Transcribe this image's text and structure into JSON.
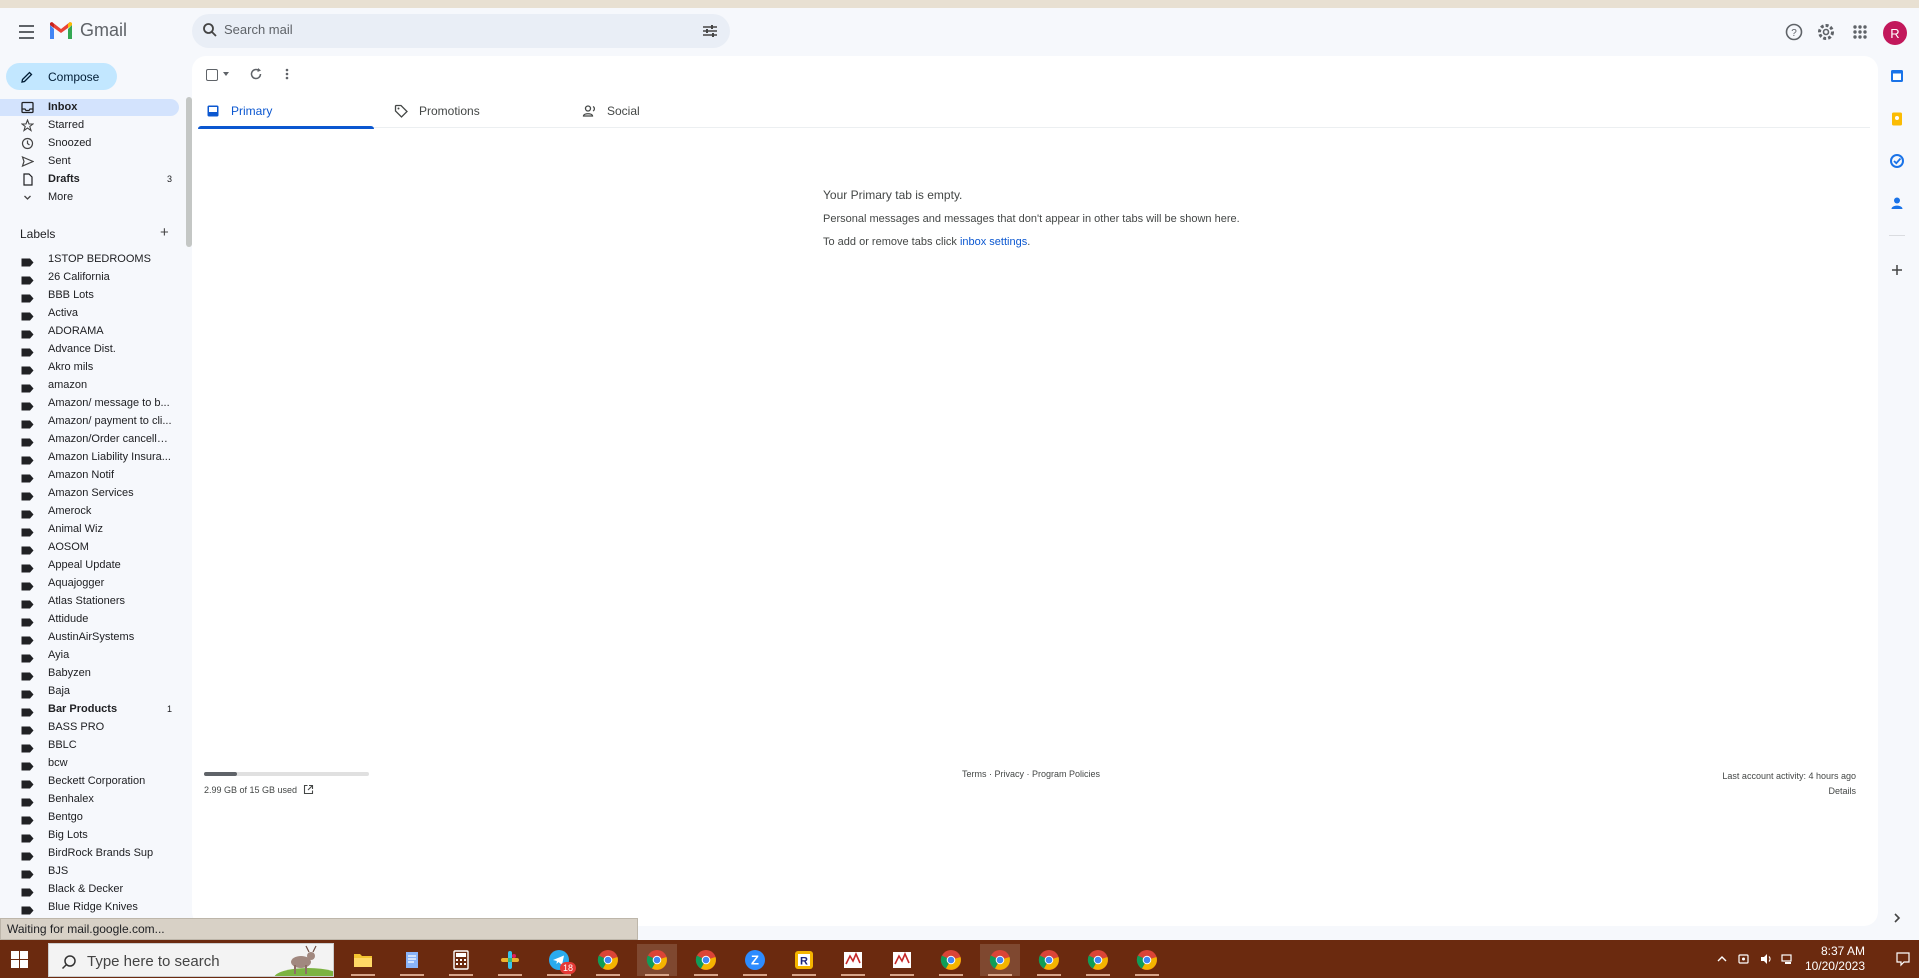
{
  "app": {
    "name": "Gmail"
  },
  "search": {
    "placeholder": "Search mail"
  },
  "avatar": {
    "letter": "R",
    "color": "#c2185b"
  },
  "compose": {
    "label": "Compose"
  },
  "nav": [
    {
      "label": "Inbox",
      "icon": "inbox-icon",
      "active": true,
      "bold": true,
      "count": ""
    },
    {
      "label": "Starred",
      "icon": "star-icon",
      "active": false,
      "bold": false,
      "count": ""
    },
    {
      "label": "Snoozed",
      "icon": "clock-icon",
      "active": false,
      "bold": false,
      "count": ""
    },
    {
      "label": "Sent",
      "icon": "send-icon",
      "active": false,
      "bold": false,
      "count": ""
    },
    {
      "label": "Drafts",
      "icon": "draft-icon",
      "active": false,
      "bold": true,
      "count": "3"
    },
    {
      "label": "More",
      "icon": "chevron-down-icon",
      "active": false,
      "bold": false,
      "count": ""
    }
  ],
  "labels": {
    "header": "Labels",
    "items": [
      {
        "label": "1STOP BEDROOMS",
        "bold": false,
        "count": ""
      },
      {
        "label": "26 California",
        "bold": false,
        "count": ""
      },
      {
        "label": "BBB Lots",
        "bold": false,
        "count": ""
      },
      {
        "label": "Activa",
        "bold": false,
        "count": ""
      },
      {
        "label": "ADORAMA",
        "bold": false,
        "count": ""
      },
      {
        "label": "Advance Dist.",
        "bold": false,
        "count": ""
      },
      {
        "label": "Akro mils",
        "bold": false,
        "count": ""
      },
      {
        "label": "amazon",
        "bold": false,
        "count": ""
      },
      {
        "label": "Amazon/ message to b...",
        "bold": false,
        "count": ""
      },
      {
        "label": "Amazon/ payment to cli...",
        "bold": false,
        "count": ""
      },
      {
        "label": "Amazon/Order cancella...",
        "bold": false,
        "count": ""
      },
      {
        "label": "Amazon Liability Insura...",
        "bold": false,
        "count": ""
      },
      {
        "label": "Amazon Notif",
        "bold": false,
        "count": ""
      },
      {
        "label": "Amazon Services",
        "bold": false,
        "count": ""
      },
      {
        "label": "Amerock",
        "bold": false,
        "count": ""
      },
      {
        "label": "Animal Wiz",
        "bold": false,
        "count": ""
      },
      {
        "label": "AOSOM",
        "bold": false,
        "count": ""
      },
      {
        "label": "Appeal Update",
        "bold": false,
        "count": ""
      },
      {
        "label": "Aquajogger",
        "bold": false,
        "count": ""
      },
      {
        "label": "Atlas Stationers",
        "bold": false,
        "count": ""
      },
      {
        "label": "Attidude",
        "bold": false,
        "count": ""
      },
      {
        "label": "AustinAirSystems",
        "bold": false,
        "count": ""
      },
      {
        "label": "Ayia",
        "bold": false,
        "count": ""
      },
      {
        "label": "Babyzen",
        "bold": false,
        "count": ""
      },
      {
        "label": "Baja",
        "bold": false,
        "count": ""
      },
      {
        "label": "Bar Products",
        "bold": true,
        "count": "1"
      },
      {
        "label": "BASS PRO",
        "bold": false,
        "count": ""
      },
      {
        "label": "BBLC",
        "bold": false,
        "count": ""
      },
      {
        "label": "bcw",
        "bold": false,
        "count": ""
      },
      {
        "label": "Beckett Corporation",
        "bold": false,
        "count": ""
      },
      {
        "label": "Benhalex",
        "bold": false,
        "count": ""
      },
      {
        "label": "Bentgo",
        "bold": false,
        "count": ""
      },
      {
        "label": "Big Lots",
        "bold": false,
        "count": ""
      },
      {
        "label": "BirdRock Brands Sup",
        "bold": false,
        "count": ""
      },
      {
        "label": "BJS",
        "bold": false,
        "count": ""
      },
      {
        "label": "Black & Decker",
        "bold": false,
        "count": ""
      },
      {
        "label": "Blue Ridge Knives",
        "bold": false,
        "count": ""
      }
    ]
  },
  "tabs": [
    {
      "label": "Primary",
      "icon": "inbox-tab-icon",
      "active": true
    },
    {
      "label": "Promotions",
      "icon": "tag-icon",
      "active": false
    },
    {
      "label": "Social",
      "icon": "people-icon",
      "active": false
    }
  ],
  "empty": {
    "title": "Your Primary tab is empty.",
    "message": "Personal messages and messages that don't appear in other tabs will be shown here.",
    "hint_prefix": "To add or remove tabs click ",
    "hint_link": "inbox settings",
    "hint_suffix": "."
  },
  "footer": {
    "storage_text": "2.99 GB of 15 GB used",
    "storage_fraction": 0.199,
    "links": [
      "Terms",
      "Privacy",
      "Program Policies"
    ],
    "link_separator": " · ",
    "activity": "Last account activity: 4 hours ago",
    "details": "Details"
  },
  "status_bar": {
    "text": "Waiting for mail.google.com..."
  },
  "taskbar": {
    "search_placeholder": "Type here to search",
    "apps": [
      {
        "name": "file-explorer-icon",
        "color": "#f4c430",
        "active": false,
        "badge": ""
      },
      {
        "name": "notepad-icon",
        "color": "#8ab4f8",
        "active": false,
        "badge": ""
      },
      {
        "name": "calculator-icon",
        "color": "#ffffff",
        "active": false,
        "badge": ""
      },
      {
        "name": "slack-icon",
        "color": "#36c5f0",
        "active": false,
        "badge": ""
      },
      {
        "name": "telegram-icon",
        "color": "#2aabee",
        "active": false,
        "badge": "18"
      },
      {
        "name": "chrome-icon",
        "color": "#34a853",
        "active": false,
        "badge": ""
      },
      {
        "name": "chrome-icon",
        "color": "#34a853",
        "active": true,
        "badge": ""
      },
      {
        "name": "chrome-icon",
        "color": "#34a853",
        "active": false,
        "badge": ""
      },
      {
        "name": "zoom-icon",
        "color": "#2d8cff",
        "active": false,
        "badge": ""
      },
      {
        "name": "r-app-icon",
        "color": "#f4b400",
        "active": false,
        "badge": ""
      },
      {
        "name": "stock-chart-icon",
        "color": "#ffffff",
        "active": false,
        "badge": ""
      },
      {
        "name": "stock-chart-icon",
        "color": "#ffffff",
        "active": false,
        "badge": ""
      },
      {
        "name": "chrome-icon",
        "color": "#34a853",
        "active": false,
        "badge": ""
      },
      {
        "name": "chrome-icon",
        "color": "#34a853",
        "active": true,
        "badge": ""
      },
      {
        "name": "chrome-icon",
        "color": "#34a853",
        "active": false,
        "badge": ""
      },
      {
        "name": "chrome-icon",
        "color": "#34a853",
        "active": false,
        "badge": ""
      },
      {
        "name": "chrome-icon",
        "color": "#34a853",
        "active": false,
        "badge": ""
      }
    ],
    "time": "8:37 AM",
    "date": "10/20/2023"
  },
  "colors": {
    "accent": "#0b57d0",
    "compose_bg": "#c2e7ff",
    "active_nav_bg": "#d3e3fd",
    "taskbar_bg": "#6b2a0f"
  }
}
